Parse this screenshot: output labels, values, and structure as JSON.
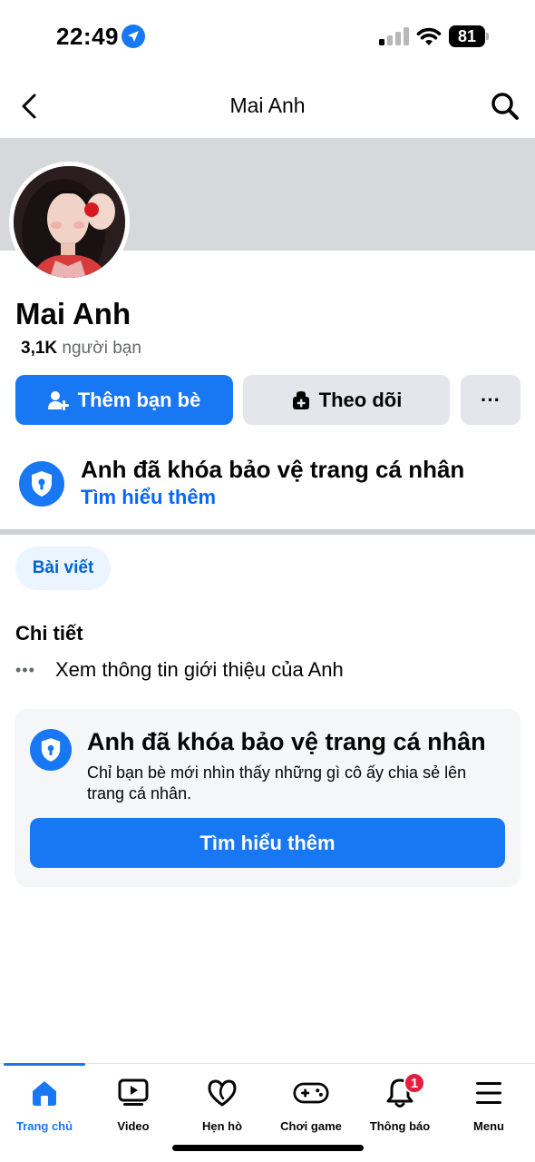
{
  "status_bar": {
    "time": "22:49",
    "battery": "81"
  },
  "header": {
    "title": "Mai Anh"
  },
  "profile": {
    "name": "Mai Anh",
    "friends_count": "3,1K",
    "friends_label": "người bạn"
  },
  "actions": {
    "add_friend": "Thêm bạn bè",
    "follow": "Theo dõi",
    "more": "···"
  },
  "lock_notice": {
    "title": "Anh đã khóa bảo vệ trang cá nhân",
    "link": "Tìm hiểu thêm"
  },
  "tabs": {
    "posts": "Bài viết"
  },
  "details": {
    "heading": "Chi tiết",
    "dots": "•••",
    "intro": "Xem thông tin giới thiệu của Anh"
  },
  "locked_card": {
    "title": "Anh đã khóa bảo vệ trang cá nhân",
    "description": "Chỉ bạn bè mới nhìn thấy những gì cô ấy chia sẻ lên trang cá nhân.",
    "button": "Tìm hiểu thêm"
  },
  "bottom_nav": {
    "items": [
      {
        "label": "Trang chủ",
        "icon": "home-icon"
      },
      {
        "label": "Video",
        "icon": "video-icon"
      },
      {
        "label": "Hẹn hò",
        "icon": "heart-icon"
      },
      {
        "label": "Chơi game",
        "icon": "gamepad-icon"
      },
      {
        "label": "Thông báo",
        "icon": "bell-icon"
      },
      {
        "label": "Menu",
        "icon": "hamburger-icon"
      }
    ],
    "notification_badge": "1"
  },
  "colors": {
    "accent": "#1877f2",
    "link": "#0866ff",
    "badge": "#e41e3f",
    "cover": "#d6d8dc",
    "secondary_button": "#e4e6eb"
  }
}
